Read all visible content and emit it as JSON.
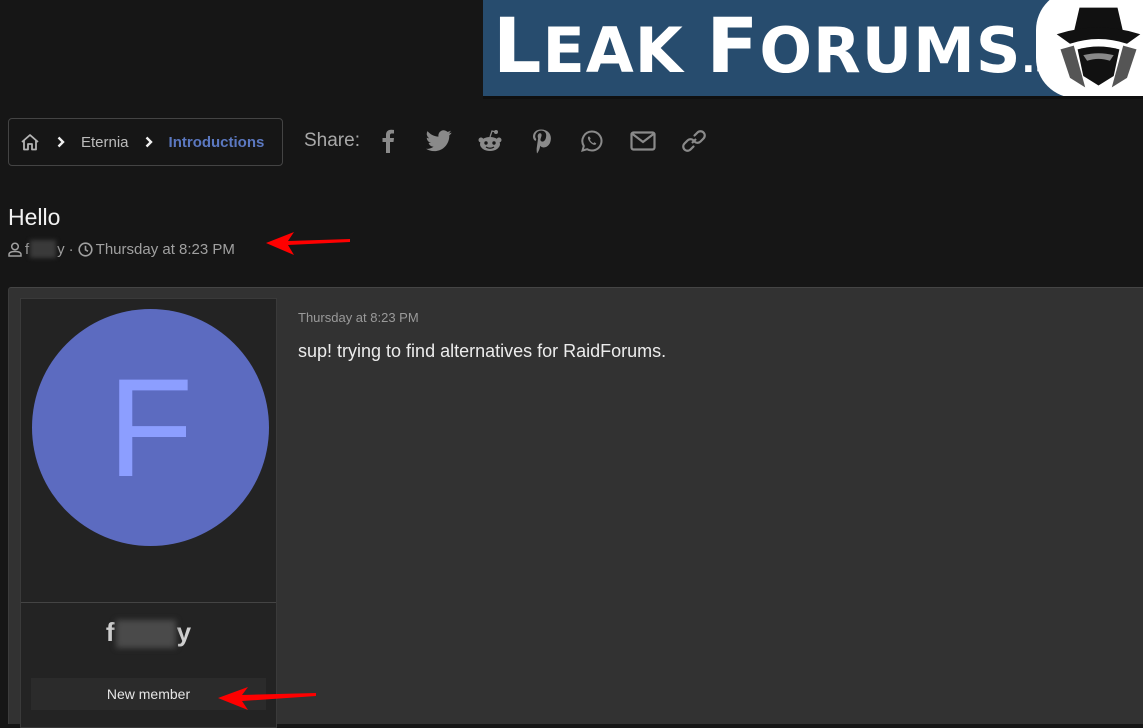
{
  "banner": {
    "text_first": "L",
    "text_rest": "EAK ",
    "text_second_first": "F",
    "text_second_rest": "ORUMS",
    "tld": ".su",
    "logo_icon": "spy-hat-icon"
  },
  "breadcrumb": {
    "home_icon": "home-icon",
    "items": [
      {
        "label": "Eternia"
      },
      {
        "label": "Introductions",
        "active": true
      }
    ]
  },
  "share": {
    "label": "Share:",
    "icons": [
      "facebook-icon",
      "twitter-icon",
      "reddit-icon",
      "pinterest-icon",
      "whatsapp-icon",
      "email-icon",
      "link-icon"
    ]
  },
  "thread": {
    "title": "Hello",
    "author_start": "f",
    "author_end": "y",
    "separator": "·",
    "date": "Thursday at 8:23 PM"
  },
  "post": {
    "avatar_letter": "F",
    "username_start": "f",
    "username_end": "y",
    "user_title": "New member",
    "date": "Thursday at 8:23 PM",
    "body": "sup! trying to find alternatives for RaidForums."
  },
  "colors": {
    "background": "#161616",
    "banner": "#274c6e",
    "accent_link": "#5b78c0",
    "avatar_bg": "#5c6bc0",
    "avatar_letter": "#8c9eff",
    "annotation_arrow": "#ff0000"
  }
}
